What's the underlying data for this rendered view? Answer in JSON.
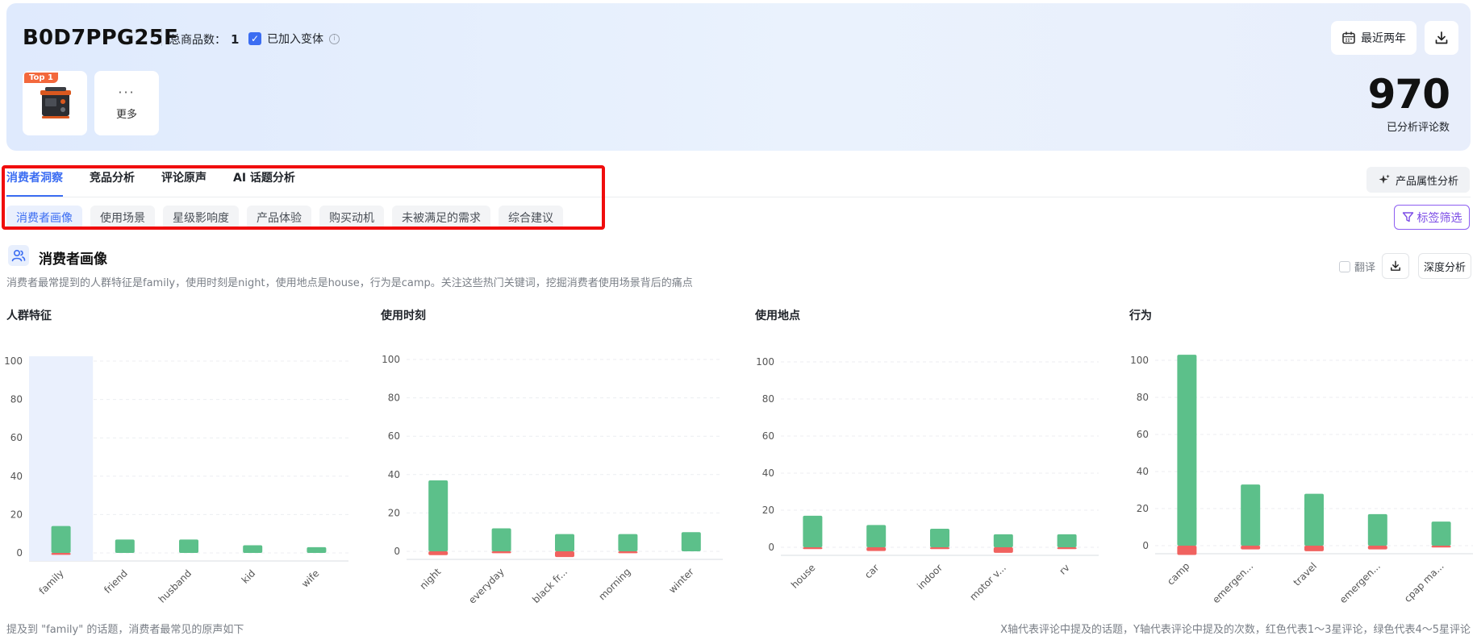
{
  "header": {
    "asin": "B0D7PPG25F",
    "total_label": "总商品数：",
    "total_value": "1",
    "variant_label": "已加入变体",
    "variant_check": "✓",
    "info_glyph": "i",
    "top_badge": "Top 1",
    "more_dots": "···",
    "more_label": "更多",
    "date_label": "最近两年",
    "review_count": "970",
    "review_count_label": "已分析评论数",
    "icons": [
      "calendar-icon",
      "download-icon",
      "info-icon"
    ]
  },
  "tabs": [
    {
      "label": "消费者洞察",
      "active": true
    },
    {
      "label": "竞品分析",
      "active": false
    },
    {
      "label": "评论原声",
      "active": false
    },
    {
      "label": "AI 话题分析",
      "active": false
    }
  ],
  "attr_button": "产品属性分析",
  "subtabs": [
    {
      "label": "消费者画像",
      "active": true
    },
    {
      "label": "使用场景",
      "active": false
    },
    {
      "label": "星级影响度",
      "active": false
    },
    {
      "label": "产品体验",
      "active": false
    },
    {
      "label": "购买动机",
      "active": false
    },
    {
      "label": "未被满足的需求",
      "active": false
    },
    {
      "label": "综合建议",
      "active": false
    }
  ],
  "filter_button": "标签筛选",
  "section": {
    "title": "消费者画像",
    "description": "消费者最常提到的人群特征是family，使用时刻是night，使用地点是house，行为是camp。关注这些热门关键词，挖掘消费者使用场景背后的痛点",
    "translate_label": "翻译",
    "deep_button": "深度分析"
  },
  "colors": {
    "positive": "#5cc08a",
    "negative": "#f0625f",
    "accent": "#3b6df2",
    "highlight": "#eaf0fd"
  },
  "chart_data": [
    {
      "type": "bar",
      "title": "人群特征",
      "categories": [
        "family",
        "friend",
        "husband",
        "kid",
        "wife"
      ],
      "series": [
        {
          "name": "红色代表1～3星评论",
          "values": [
            1,
            0,
            0,
            0,
            0
          ]
        },
        {
          "name": "绿色代表4～5星评论",
          "values": [
            14,
            7,
            7,
            4,
            3
          ]
        }
      ],
      "highlighted": "family",
      "ylim": [
        0,
        100
      ],
      "yticks": [
        0,
        20,
        40,
        60,
        80,
        100
      ]
    },
    {
      "type": "bar",
      "title": "使用时刻",
      "categories": [
        "night",
        "everyday",
        "black fr...",
        "morning",
        "winter"
      ],
      "series": [
        {
          "name": "红色代表1～3星评论",
          "values": [
            2,
            1,
            3,
            1,
            0
          ]
        },
        {
          "name": "绿色代表4～5星评论",
          "values": [
            37,
            12,
            9,
            9,
            10
          ]
        }
      ],
      "ylim": [
        0,
        100
      ],
      "yticks": [
        0,
        20,
        40,
        60,
        80,
        100
      ]
    },
    {
      "type": "bar",
      "title": "使用地点",
      "categories": [
        "house",
        "car",
        "indoor",
        "motor v...",
        "rv"
      ],
      "series": [
        {
          "name": "红色代表1～3星评论",
          "values": [
            1,
            2,
            1,
            3,
            1
          ]
        },
        {
          "name": "绿色代表4～5星评论",
          "values": [
            17,
            12,
            10,
            7,
            7
          ]
        }
      ],
      "ylim": [
        0,
        100
      ],
      "yticks": [
        0,
        20,
        40,
        60,
        80,
        100
      ]
    },
    {
      "type": "bar",
      "title": "行为",
      "categories": [
        "camp",
        "emergen...",
        "travel",
        "emergen...",
        "cpap ma..."
      ],
      "series": [
        {
          "name": "红色代表1～3星评论",
          "values": [
            5,
            2,
            3,
            2,
            1
          ]
        },
        {
          "name": "绿色代表4～5星评论",
          "values": [
            103,
            33,
            28,
            17,
            13
          ]
        }
      ],
      "ylim": [
        0,
        100
      ],
      "yticks": [
        0,
        20,
        40,
        60,
        80,
        100
      ]
    }
  ],
  "footer": {
    "left": "提及到 \"family\" 的话题，消费者最常见的原声如下",
    "right": "X轴代表评论中提及的话题，Y轴代表评论中提及的次数，红色代表1～3星评论，绿色代表4～5星评论"
  }
}
